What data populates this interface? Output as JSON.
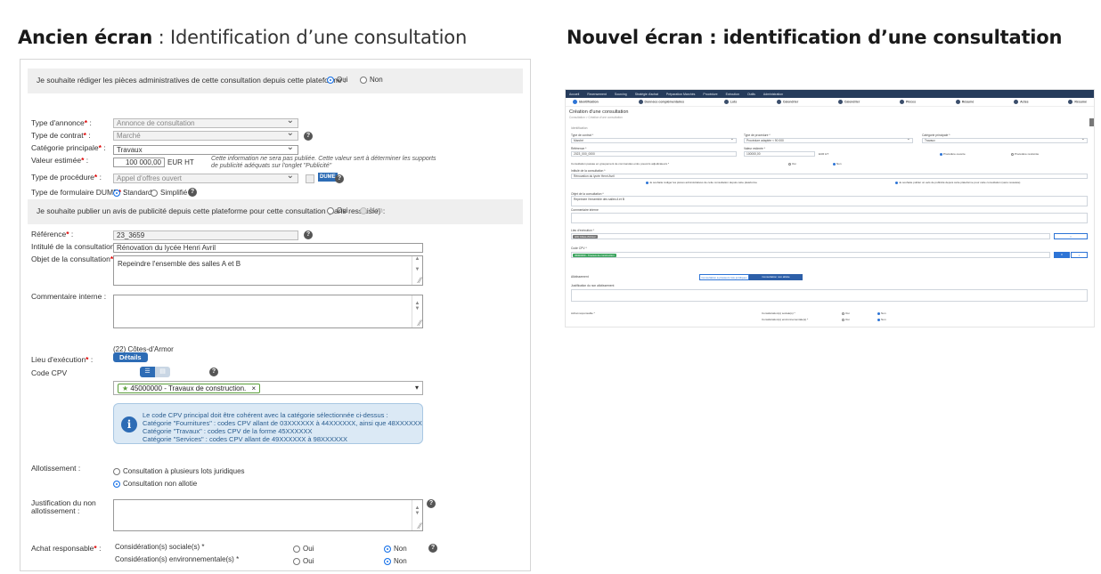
{
  "headers": {
    "old_bold": "Ancien écran",
    "old_rest": " : Identification d’une consultation",
    "new_title": "Nouvel écran : identification d’une consultation"
  },
  "old": {
    "rediger_question": "Je souhaite rédiger les pièces administratives de cette consultation depuis cette plateforme :",
    "oui": "Oui",
    "non": "Non",
    "type_annonce_label": "Type d'annonce",
    "type_annonce_value": "Annonce de consultation",
    "type_contrat_label": "Type de contrat",
    "type_contrat_value": "Marché",
    "categorie_label": "Catégorie principale",
    "categorie_value": "Travaux",
    "valeur_label": "Valeur estimée",
    "valeur_value": "100 000,00",
    "valeur_unit": "EUR HT",
    "valeur_note": "Cette information ne sera pas publiée. Cette valeur sert à déterminer les supports de publicité adéquats sur l'onglet \"Publicité\"",
    "procedure_label": "Type de procédure",
    "procedure_value": "Appel d'offres ouvert",
    "dume_badge": "DUME",
    "formulaire_label": "Type de formulaire DUME",
    "standard": "Standard",
    "simplifie": "Simplifié",
    "publier_question": "Je souhaite publier un avis de publicité depuis cette plateforme pour cette consultation (sans ressaisie) :",
    "reference_label": "Référence",
    "reference_value": "23_3659",
    "intitule_label": "Intitulé de la consultation",
    "intitule_value": "Rénovation du lycée Henri Avril",
    "objet_label": "Objet de la consultation",
    "objet_value": "Repeindre l'ensemble des salles A et B",
    "commentaire_label": "Commentaire interne :",
    "lieu_label": "Lieu d'exécution",
    "lieu_value": "(22) Côtes-d'Armor",
    "details_button": "Détails",
    "cpv_label": "Code CPV",
    "cpv_tag": "45000000 - Travaux de construction.",
    "cpv_info": [
      "Le code CPV principal doit être cohérent avec la catégorie sélectionnée ci-dessus :",
      "Catégorie \"Fournitures\" : codes CPV allant de 03XXXXXX à 44XXXXXX, ainsi que 48XXXXXX",
      "Catégorie \"Travaux\" : codes CPV de la forme 45XXXXXX",
      "Catégorie \"Services\" : codes CPV allant de 49XXXXXX à 98XXXXXX"
    ],
    "allot_label": "Allotissement :",
    "allot_opt1": "Consultation à plusieurs lots juridiques",
    "allot_opt2": "Consultation non allotie",
    "justif_label": "Justification du non allotissement :",
    "achat_label": "Achat responsable",
    "consid_sociale": "Considération(s) sociale(s) *",
    "consid_env": "Considération(s) environnementale(s) *"
  },
  "new": {
    "nav": [
      "Accueil",
      "Recensement",
      "Sourcing",
      "Stratégie d'achat",
      "Préparation Marchés",
      "Procédure",
      "Exécution",
      "Outils",
      "Administration"
    ],
    "steps": [
      "Identification",
      "Données complémentaires",
      "Lots",
      "Calendrier",
      "Calendrier",
      "Pièces",
      "Résumé",
      "Actes",
      "Résumé"
    ],
    "page_title": "Création d'une consultation",
    "breadcrumb": "Consultation > Création d'une consultation",
    "section": "Identification",
    "type_contrat": "Type de contrat *",
    "type_contrat_val": "Marché",
    "type_procedure": "Type de procédure *",
    "type_procedure_val": "Procédure adaptée < 90 000",
    "categorie": "Catégorie principale *",
    "categorie_val": "Travaux",
    "reference": "Référence *",
    "reference_val": "2023_000_0000",
    "valeur": "Valeur estimée *",
    "valeur_val": "100000,00",
    "eur": "EUR HT",
    "proc_ouverte": "Procédure ouverte",
    "proc_restreinte": "Procédure restreinte",
    "consultation_q": "Consultation passée en groupement de commandes entre pouvoirs adjudicateurs *",
    "oui": "Oui",
    "non": "Non",
    "intitule": "Intitulé de la consultation *",
    "intitule_val": "Rénovation du lycée Henri Avril",
    "chk1": "Je souhaite rédiger les pièces administratives de cette consultation depuis cette plateforme",
    "chk2": "Je souhaite publier un avis de publicité depuis cette plateforme pour cette consultation (sans ressaisie)",
    "objet": "Objet de la consultation *",
    "objet_val": "Repeindre l'ensemble des salles A et B",
    "commentaire": "Commentaire interne",
    "lieu": "Lieu d'exécution *",
    "lieu_chip": "(22) Côtes-d'Armor",
    "cpv": "Code CPV *",
    "cpv_chip": "45000000 - Travaux de construction",
    "allot": "Allotissement",
    "allot_btn1": "Consultation à plusieurs lots juridiques",
    "allot_btn2": "Consultation non allotie",
    "justif": "Justification du non allotissement",
    "achat": "Achat responsable *",
    "consid_soc": "Considération(s) sociale(s) *",
    "consid_env": "Considération(s) environnementale(s) *"
  }
}
